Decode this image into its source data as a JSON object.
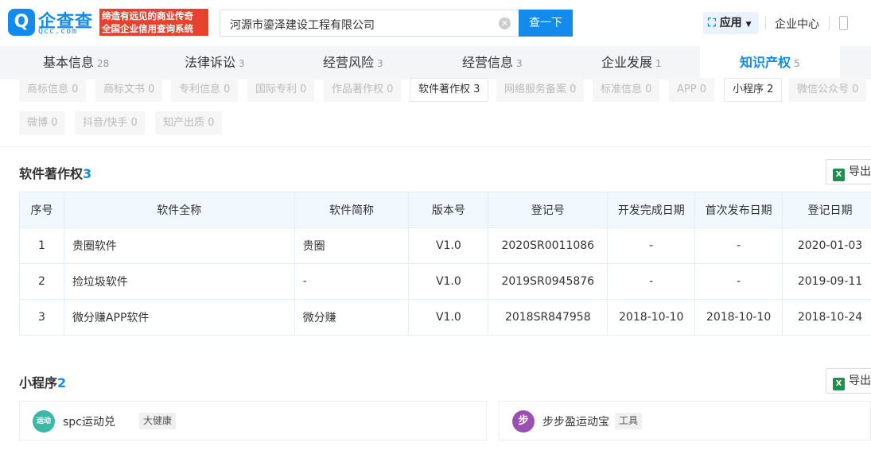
{
  "header": {
    "logo_glyph": "Q",
    "logo_text": "企查查",
    "logo_sub": "Qcc.com",
    "slogan_line1": "缔造有远见的商业传奇",
    "slogan_line2": "全国企业信用查询系统",
    "search_value": "河源市鎏泽建设工程有限公司",
    "search_button": "查一下",
    "apps_label": "应用",
    "enterprise_center": "企业中心"
  },
  "tabs": [
    {
      "label": "基本信息",
      "count": "28"
    },
    {
      "label": "法律诉讼",
      "count": "3"
    },
    {
      "label": "经营风险",
      "count": "3"
    },
    {
      "label": "经营信息",
      "count": "3"
    },
    {
      "label": "企业发展",
      "count": "1"
    },
    {
      "label": "知识产权",
      "count": "5"
    }
  ],
  "subtabs": [
    "商标信息 0",
    "商标文书 0",
    "专利信息 0",
    "国际专利 0",
    "作品著作权 0",
    "软件著作权 3",
    "网络服务备案 0",
    "标准信息 0",
    "APP 0",
    "小程序 2",
    "微信公众号 0",
    "微博 0",
    "抖音/快手 0",
    "知产出质 0"
  ],
  "software": {
    "title": "软件著作权",
    "count": "3",
    "export_label": "导出",
    "columns": [
      "序号",
      "软件全称",
      "软件简称",
      "版本号",
      "登记号",
      "开发完成日期",
      "首次发布日期",
      "登记日期"
    ],
    "rows": [
      [
        "1",
        "贵圈软件",
        "贵圈",
        "V1.0",
        "2020SR0011086",
        "-",
        "-",
        "2020-01-03"
      ],
      [
        "2",
        "捡垃圾软件",
        "-",
        "V1.0",
        "2019SR0945876",
        "-",
        "-",
        "2019-09-11"
      ],
      [
        "3",
        "微分赚APP软件",
        "微分赚",
        "V1.0",
        "2018SR847958",
        "2018-10-10",
        "2018-10-10",
        "2018-10-24"
      ]
    ]
  },
  "miniprogram": {
    "title": "小程序",
    "count": "2",
    "export_label": "导出",
    "items": [
      {
        "icon_text": "运动",
        "name": "spc运动兑",
        "tag": "大健康",
        "color": "#3cb8a9"
      },
      {
        "icon_text": "步",
        "name": "步步盈运动宝",
        "tag": "工具",
        "color": "#9c4fb3"
      }
    ]
  },
  "colors": {
    "brand": "#128bed",
    "slogan_bg": "#e8422f",
    "table_header": "#f2f9fe"
  }
}
